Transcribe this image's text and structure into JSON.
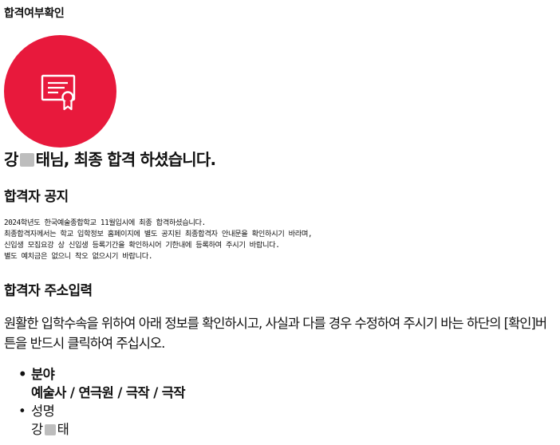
{
  "page": {
    "title": "합격여부확인"
  },
  "badge": {
    "icon": "certificate-icon",
    "color": "#e8193c"
  },
  "result": {
    "name_first": "강",
    "name_last": "태님, 최종 합격 하셨습니다."
  },
  "notice": {
    "title": "합격자 공지",
    "lines": [
      "2024학년도 한국예술종합학교 11월입시에 최종 합격하셨습니다.",
      "최종합격자께서는 학교 입학정보 홈페이지에 별도 공지된 최종합격자 안내문을 확인하시기 바라며,",
      "신입생 모집요강 상 신입생 등록기간을 확인하시어 기한내에 등록하여 주시기 바랍니다.",
      "별도 예치금은 없으니 착오 없으시기 바랍니다."
    ]
  },
  "address": {
    "title": "합격자 주소입력",
    "intro": "원활한 입학수속을 위하여 아래 정보를 확인하시고, 사실과 다를 경우 수정하여 주시기 바는 하단의 [확인]버튼을 반드시 클릭하여 주십시오.",
    "fields": [
      {
        "label": "분야",
        "value": "예술사 / 연극원 / 극작 / 극작"
      },
      {
        "label": "성명",
        "value_first": "강",
        "value_last": "태"
      }
    ]
  }
}
